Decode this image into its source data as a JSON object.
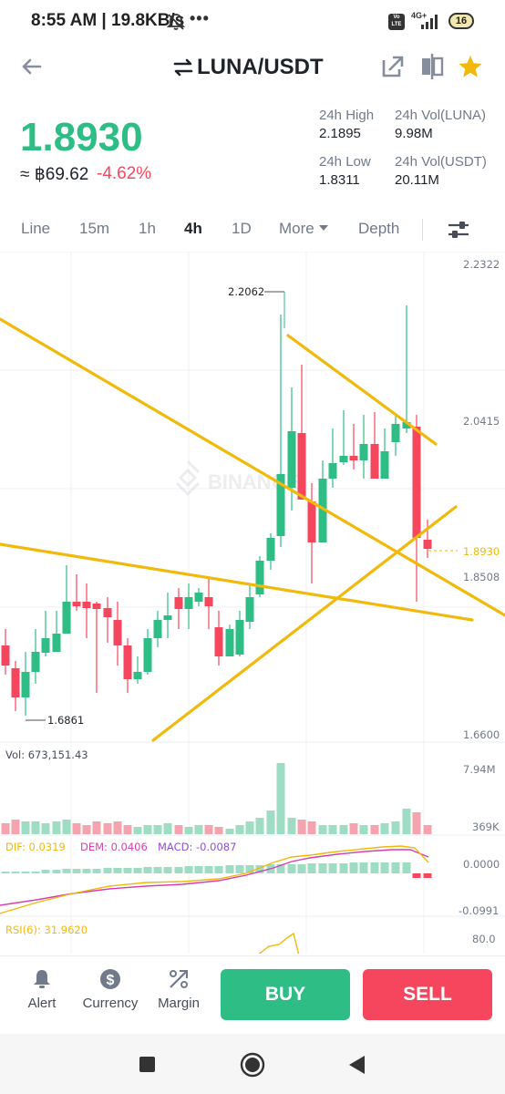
{
  "status_bar": {
    "time": "8:55 AM",
    "speed": "19.8KB/s",
    "network_label": "4G+",
    "volte_label": "Vo LTE",
    "battery": "16"
  },
  "header": {
    "pair": "LUNA/USDT",
    "star_color": "#f0b90b"
  },
  "price": {
    "last": "1.8930",
    "fiat": "≈ ฿69.62",
    "change": "-4.62%",
    "up_color": "#2ebd85",
    "down_color": "#f6465d"
  },
  "stats": {
    "high_label": "24h High",
    "high_value": "2.1895",
    "vol_base_label": "24h Vol(LUNA)",
    "vol_base_value": "9.98M",
    "low_label": "24h Low",
    "low_value": "1.8311",
    "vol_quote_label": "24h Vol(USDT)",
    "vol_quote_value": "20.11M"
  },
  "interval_tabs": [
    {
      "label": "Line"
    },
    {
      "label": "15m"
    },
    {
      "label": "1h"
    },
    {
      "label": "4h",
      "active": true
    },
    {
      "label": "1D"
    },
    {
      "label": "More"
    },
    {
      "label": "Depth"
    }
  ],
  "chart": {
    "watermark": "BINANCE",
    "price_axis": [
      "2.2322",
      "2.0415",
      "1.8930",
      "1.8508",
      "1.6600"
    ],
    "high_marker": "2.2062",
    "low_marker": "1.6861",
    "volume_label": "Vol: 673,151.43",
    "volume_axis": [
      "7.94M",
      "369K"
    ],
    "macd": {
      "dif": "DIF: 0.0319",
      "dem": "DEM: 0.0406",
      "macd": "MACD: -0.0087",
      "axis": [
        "0.0000",
        "-0.0991"
      ]
    },
    "rsi": {
      "label": "RSI(6): 31.9620",
      "axis": "80.0"
    }
  },
  "bottom_bar": {
    "alert_label": "Alert",
    "currency_label": "Currency",
    "margin_label": "Margin",
    "buy_label": "BUY",
    "sell_label": "SELL"
  }
}
